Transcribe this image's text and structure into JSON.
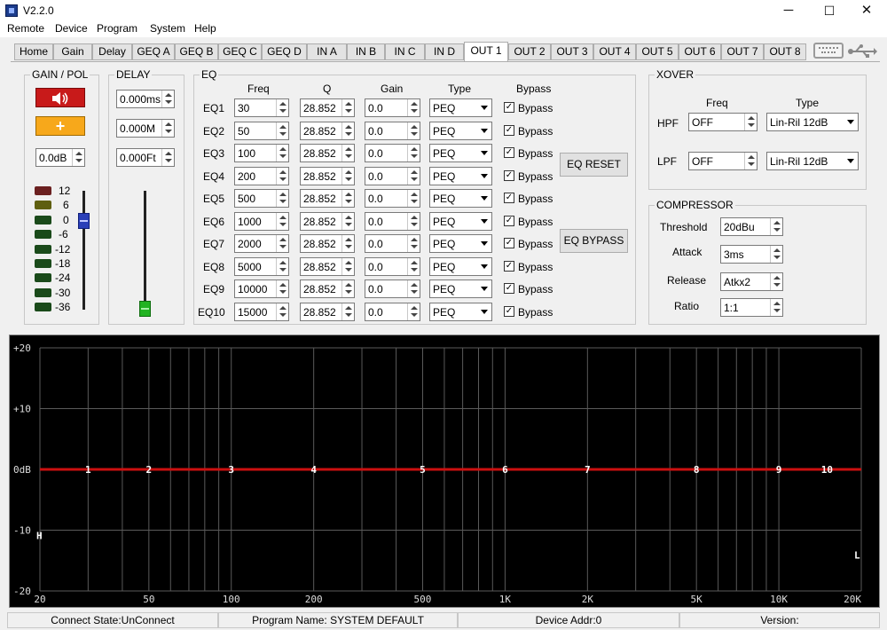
{
  "app": {
    "version_title": "V2.2.0"
  },
  "window_controls": {
    "minimize": "─",
    "maximize": "☐",
    "close": "✕"
  },
  "menu": [
    "Remote",
    "Device",
    "Program",
    "System",
    "Help"
  ],
  "tabs": [
    "Home",
    "Gain",
    "Delay",
    "GEQ A",
    "GEQ B",
    "GEQ C",
    "GEQ D",
    "IN A",
    "IN B",
    "IN C",
    "IN D",
    "OUT 1",
    "OUT 2",
    "OUT 3",
    "OUT 4",
    "OUT 5",
    "OUT 6",
    "OUT 7",
    "OUT 8"
  ],
  "active_tab": "OUT 1",
  "gain_pol": {
    "title": "GAIN / POL",
    "mute_icon": "speaker-icon",
    "polarity_label": "+",
    "gain_value": "0.0dB",
    "meter_labels": [
      "12",
      "6",
      "0",
      "-6",
      "-12",
      "-18",
      "-24",
      "-30",
      "-36"
    ],
    "meter_colors": [
      "#6b2020",
      "#5f5f10",
      "#1a4a1a",
      "#1a4a1a",
      "#1a4a1a",
      "#1a4a1a",
      "#1a4a1a",
      "#1a4a1a",
      "#1a4a1a"
    ],
    "slider_level_db": 0
  },
  "delay": {
    "title": "DELAY",
    "ms": "0.000ms",
    "meters": "0.000M",
    "feet": "0.000Ft",
    "slider_level": 0
  },
  "eq": {
    "title": "EQ",
    "headers": {
      "freq": "Freq",
      "q": "Q",
      "gain": "Gain",
      "type": "Type",
      "bypass": "Bypass"
    },
    "rows": [
      {
        "label": "EQ1",
        "freq": "30",
        "q": "28.852",
        "gain": "0.0",
        "type": "PEQ",
        "bypass": "Bypass"
      },
      {
        "label": "EQ2",
        "freq": "50",
        "q": "28.852",
        "gain": "0.0",
        "type": "PEQ",
        "bypass": "Bypass"
      },
      {
        "label": "EQ3",
        "freq": "100",
        "q": "28.852",
        "gain": "0.0",
        "type": "PEQ",
        "bypass": "Bypass"
      },
      {
        "label": "EQ4",
        "freq": "200",
        "q": "28.852",
        "gain": "0.0",
        "type": "PEQ",
        "bypass": "Bypass"
      },
      {
        "label": "EQ5",
        "freq": "500",
        "q": "28.852",
        "gain": "0.0",
        "type": "PEQ",
        "bypass": "Bypass"
      },
      {
        "label": "EQ6",
        "freq": "1000",
        "q": "28.852",
        "gain": "0.0",
        "type": "PEQ",
        "bypass": "Bypass"
      },
      {
        "label": "EQ7",
        "freq": "2000",
        "q": "28.852",
        "gain": "0.0",
        "type": "PEQ",
        "bypass": "Bypass"
      },
      {
        "label": "EQ8",
        "freq": "5000",
        "q": "28.852",
        "gain": "0.0",
        "type": "PEQ",
        "bypass": "Bypass"
      },
      {
        "label": "EQ9",
        "freq": "10000",
        "q": "28.852",
        "gain": "0.0",
        "type": "PEQ",
        "bypass": "Bypass"
      },
      {
        "label": "EQ10",
        "freq": "15000",
        "q": "28.852",
        "gain": "0.0",
        "type": "PEQ",
        "bypass": "Bypass"
      }
    ],
    "reset_button": "EQ RESET",
    "bypass_button": "EQ BYPASS"
  },
  "xover": {
    "title": "XOVER",
    "freq_header": "Freq",
    "type_header": "Type",
    "hpf": {
      "label": "HPF",
      "freq": "OFF",
      "type": "Lin-Ril 12dB"
    },
    "lpf": {
      "label": "LPF",
      "freq": "OFF",
      "type": "Lin-Ril 12dB"
    }
  },
  "compressor": {
    "title": "COMPRESSOR",
    "threshold": {
      "label": "Threshold",
      "value": "20dBu"
    },
    "attack": {
      "label": "Attack",
      "value": "3ms"
    },
    "release": {
      "label": "Release",
      "value": "Atkx2"
    },
    "ratio": {
      "label": "Ratio",
      "value": "1:1"
    }
  },
  "graph": {
    "y_labels": [
      "+20",
      "+10",
      "0dB",
      "-10",
      "-20"
    ],
    "y_values": [
      20,
      10,
      0,
      -10,
      -20
    ],
    "x_labels": [
      "20",
      "50",
      "100",
      "200",
      "500",
      "1K",
      "2K",
      "5K",
      "10K",
      "20K"
    ],
    "x_values": [
      20,
      50,
      100,
      200,
      500,
      1000,
      2000,
      5000,
      10000,
      20000
    ],
    "markers": [
      "1",
      "2",
      "3",
      "4",
      "5",
      "6",
      "7",
      "8",
      "9",
      "10"
    ],
    "marker_freqs": [
      30,
      50,
      100,
      200,
      500,
      1000,
      2000,
      5000,
      10000,
      15000
    ],
    "hpf_marker": "H",
    "lpf_marker": "L",
    "curve_color": "#cc1010"
  },
  "status": {
    "connect": "Connect State:UnConnect",
    "program": "Program Name: SYSTEM DEFAULT",
    "device": "Device Addr:0",
    "version": "Version:"
  }
}
